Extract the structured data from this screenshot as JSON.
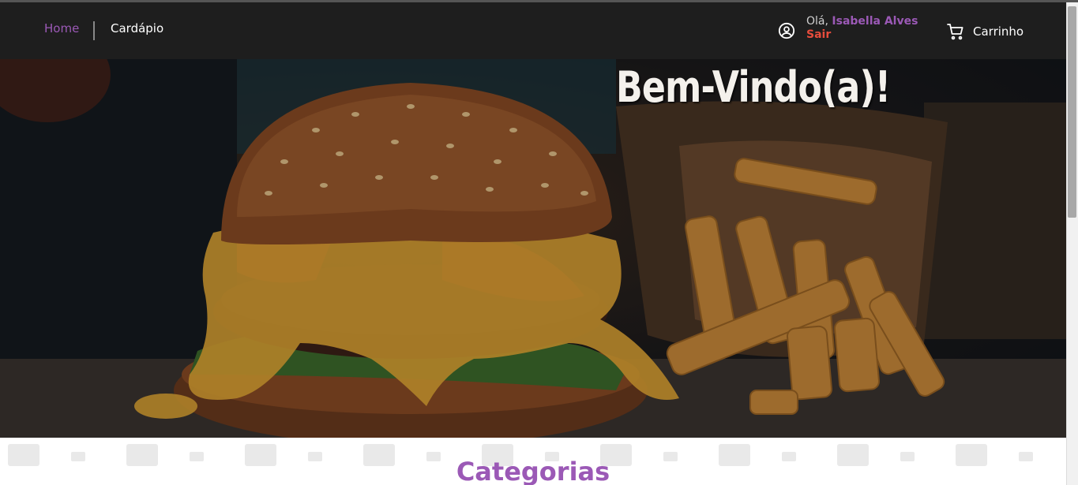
{
  "nav": {
    "home_label": "Home",
    "menu_label": "Cardápio"
  },
  "user": {
    "greeting": "Olá,",
    "name": "Isabella Alves",
    "logout_label": "Sair"
  },
  "cart": {
    "label": "Carrinho",
    "icon": "cart-icon"
  },
  "hero": {
    "title": "Bem-Vindo(a)!",
    "image": "burger-and-fries-photo"
  },
  "categories": {
    "title": "Categorias"
  },
  "colors": {
    "accent": "#9b59b6",
    "logout": "#e74c3c",
    "navbar": "#1e1e1e"
  }
}
